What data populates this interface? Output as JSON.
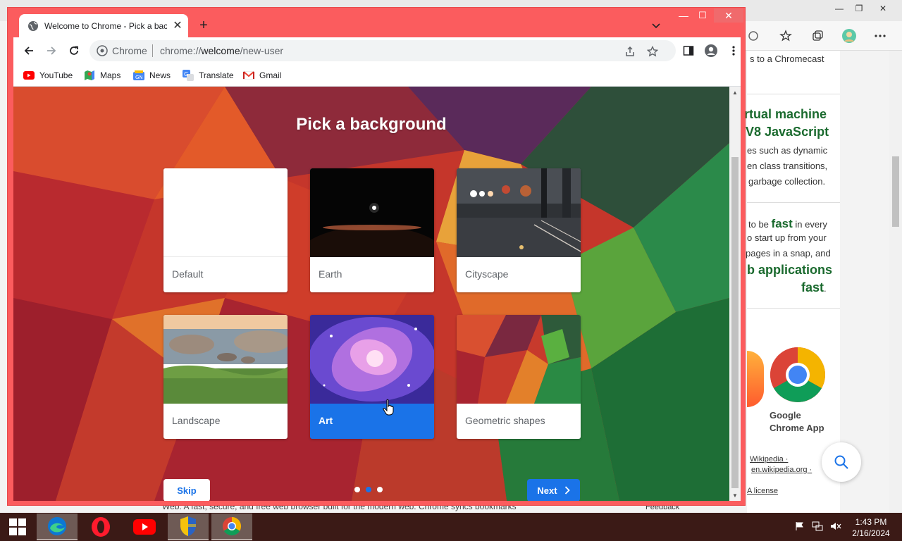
{
  "background_browser": {
    "window_controls": {
      "minimize": "—",
      "restore": "❐",
      "close": "✕"
    },
    "content_lines": [
      "s to a Chromecast",
      "es such as dynamic",
      "en class transitions,",
      "garbage collection.",
      "o start up from your",
      "pages in a snap, and"
    ],
    "headings": [
      "rtual machine",
      "V8 JavaScript",
      "b applications",
      "fast"
    ],
    "fast_line_prefix": "to be ",
    "fast_line_emph": "fast",
    "fast_line_suffix": " in every",
    "fast_period": ".",
    "app_label_line1": "Google",
    "app_label_line2": "Chrome App",
    "links": [
      "Wikipedia ·",
      "en.wikipedia.org ·",
      "A license"
    ],
    "bottom_text": "Web. A fast, secure, and free web browser built for the modern web. Chrome syncs bookmarks",
    "feedback": "Feedback"
  },
  "chrome": {
    "tab": {
      "title": "Welcome to Chrome - Pick a background",
      "close": "✕"
    },
    "new_tab": "+",
    "window_controls": {
      "minimize": "—",
      "maximize": "☐",
      "close": "✕"
    },
    "omnibox": {
      "chip": "Chrome",
      "url_prefix": "chrome://",
      "url_host": "welcome",
      "url_path": "/new-user"
    },
    "bookmarks": [
      {
        "label": "YouTube",
        "icon": "youtube-icon"
      },
      {
        "label": "Maps",
        "icon": "maps-icon"
      },
      {
        "label": "News",
        "icon": "news-icon"
      },
      {
        "label": "Translate",
        "icon": "translate-icon"
      },
      {
        "label": "Gmail",
        "icon": "gmail-icon"
      }
    ]
  },
  "welcome": {
    "title": "Pick a background",
    "backgrounds": [
      {
        "label": "Default",
        "selected": false
      },
      {
        "label": "Earth",
        "selected": false
      },
      {
        "label": "Cityscape",
        "selected": false
      },
      {
        "label": "Landscape",
        "selected": false
      },
      {
        "label": "Art",
        "selected": true
      },
      {
        "label": "Geometric shapes",
        "selected": false
      }
    ],
    "skip_label": "Skip",
    "next_label": "Next",
    "step_count": 3,
    "active_step": 2
  },
  "taskbar": {
    "apps": [
      "edge-icon",
      "opera-icon",
      "youtube-icon",
      "security-shield-icon",
      "chrome-icon"
    ],
    "time": "1:43 PM",
    "date": "2/16/2024"
  },
  "colors": {
    "chrome_frame": "#fb5c5e",
    "accent_blue": "#1a73e8",
    "taskbar": "#3b1a16",
    "desktop": "#2a9fa8"
  }
}
